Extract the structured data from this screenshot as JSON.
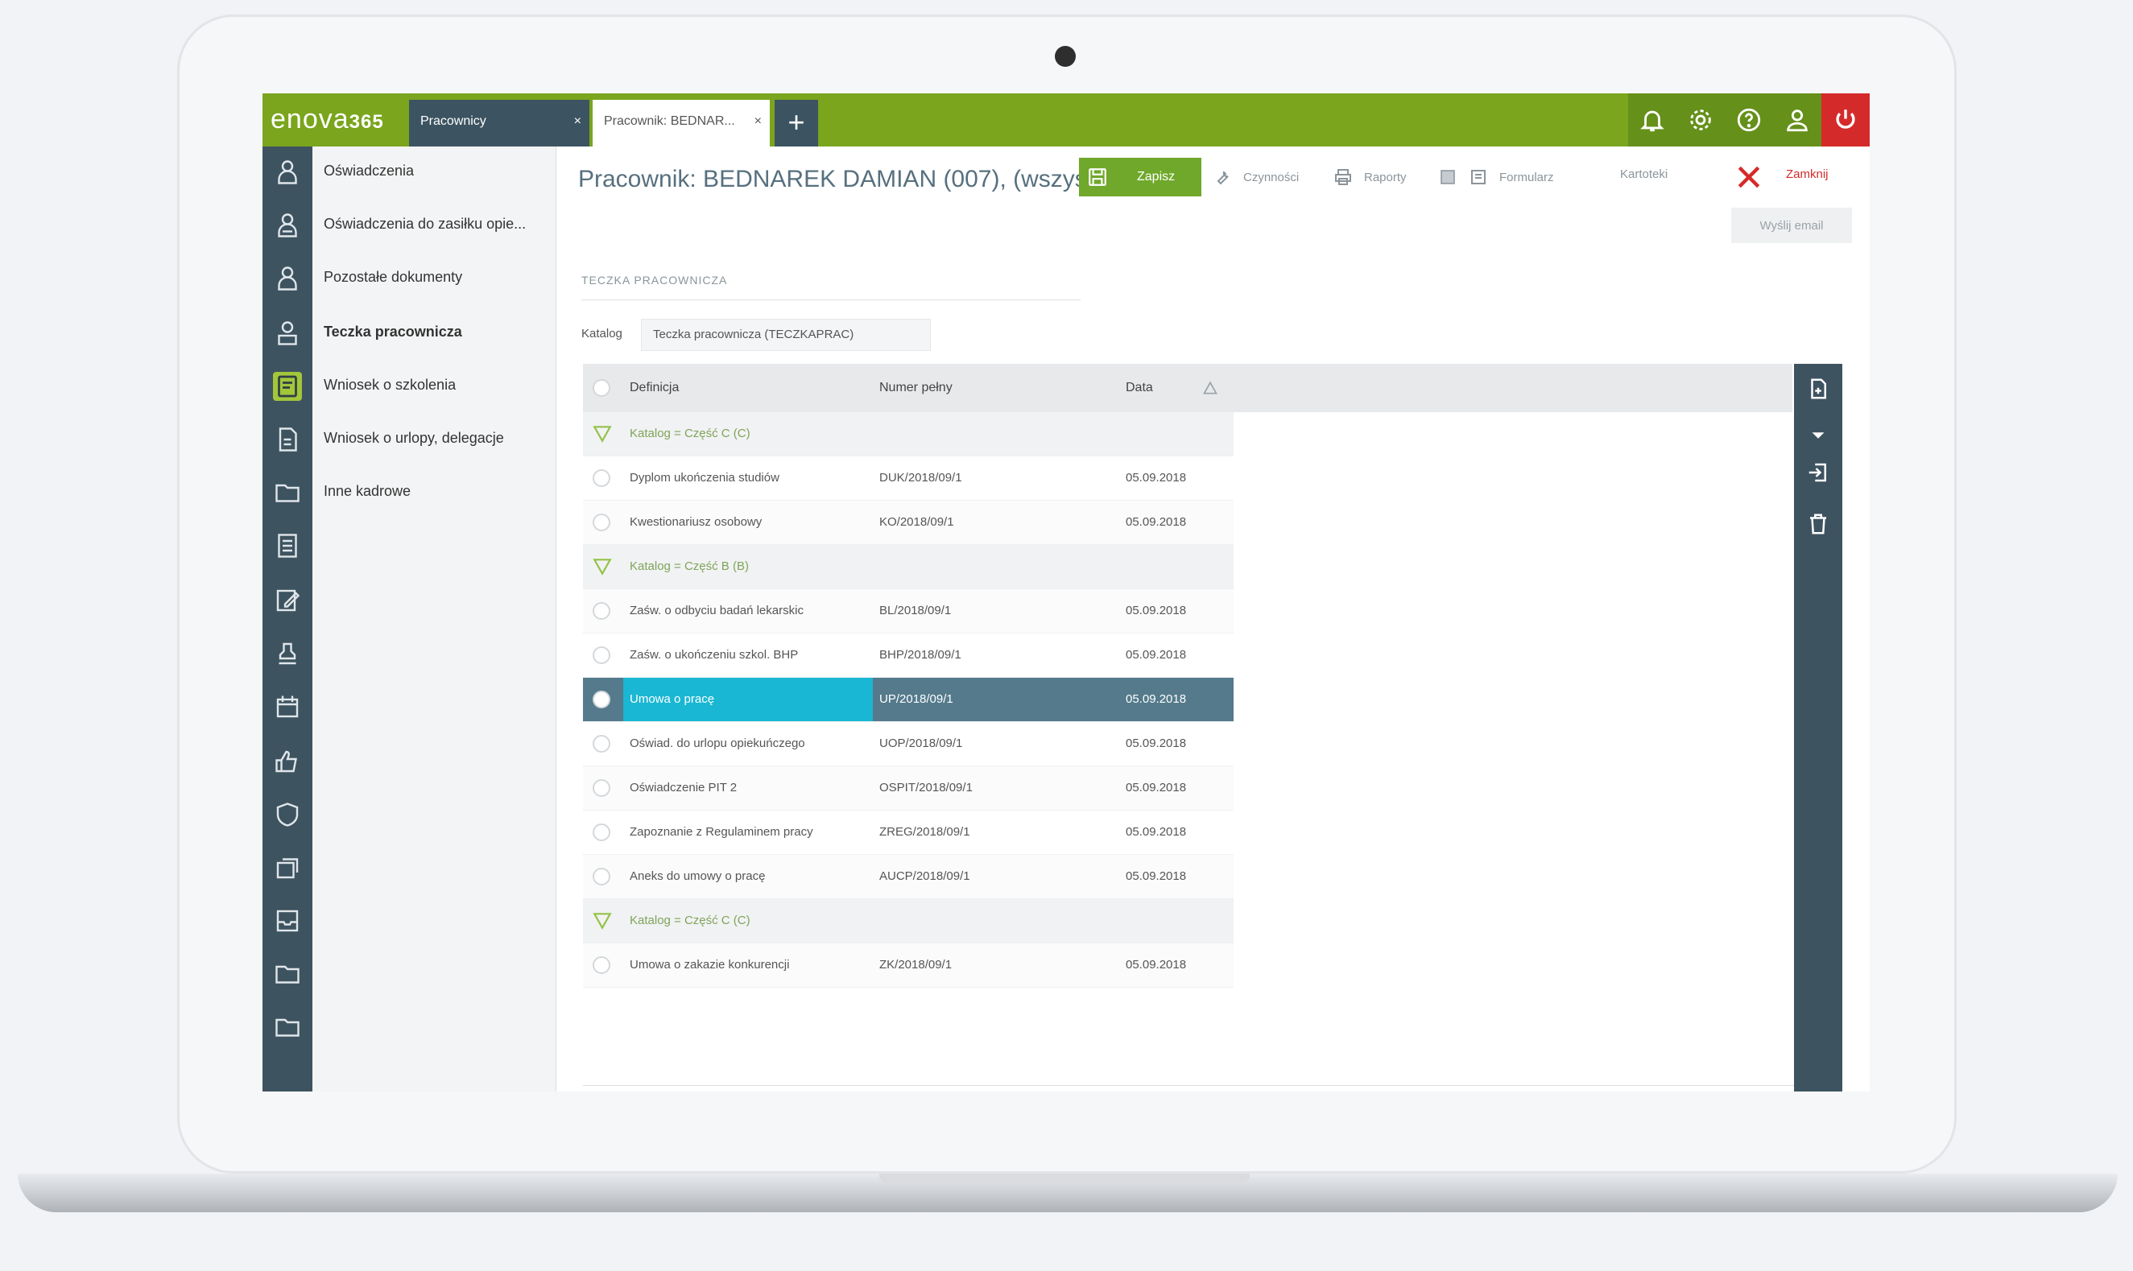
{
  "topbar": {
    "logo_text": "enova",
    "logo_number": "365",
    "tabs": [
      {
        "label": "Pracownicy",
        "close": "×"
      },
      {
        "label": "Pracownik: BEDNAR...",
        "close": "×"
      }
    ],
    "add_tab": "+",
    "icons": [
      "bell-icon",
      "gear-icon",
      "help-icon",
      "user-icon",
      "power-icon"
    ],
    "accent": "#7aa51d",
    "power_color": "#d52a2a"
  },
  "sidebar": {
    "items": [
      {
        "label": "Oświadczenia"
      },
      {
        "label": "Oświadczenia do zasiłku opie..."
      },
      {
        "label": "Pozostałe dokumenty"
      },
      {
        "label": "Teczka pracownicza"
      },
      {
        "label": "Wniosek o szkolenia"
      },
      {
        "label": "Wniosek o urlopy, delegacje"
      },
      {
        "label": "Inne kadrowe"
      }
    ]
  },
  "header": {
    "title": "Pracownik: BEDNAREK DAMIAN (007), (wszystko)",
    "save_label": "Zapisz",
    "toolbar": [
      "Czynności",
      "Raporty",
      "Formularz",
      "Kartoteki"
    ],
    "close_label": "Zamknij",
    "email_label": "Wyślij email"
  },
  "main": {
    "section_label": "TECZKA PRACOWNICZA",
    "katalog_label": "Katalog",
    "katalog_value": "Teczka pracownicza (TECZKAPRAC)",
    "columns": [
      "Definicja",
      "Numer pełny",
      "Data"
    ],
    "rows": [
      {
        "type": "group",
        "label": "Katalog = Część C (C)"
      },
      {
        "type": "row",
        "definicja": "Dyplom ukończenia studiów",
        "numer": "DUK/2018/09/1",
        "data": "05.09.2018"
      },
      {
        "type": "row",
        "definicja": "Kwestionariusz osobowy",
        "numer": "KO/2018/09/1",
        "data": "05.09.2018"
      },
      {
        "type": "group",
        "label": "Katalog = Część B (B)"
      },
      {
        "type": "row",
        "definicja": "Zaśw. o odbyciu badań lekarskic",
        "numer": "BL/2018/09/1",
        "data": "05.09.2018"
      },
      {
        "type": "row",
        "definicja": "Zaśw. o ukończeniu szkol. BHP",
        "numer": "BHP/2018/09/1",
        "data": "05.09.2018"
      },
      {
        "type": "row",
        "selected": true,
        "definicja": "Umowa o pracę",
        "numer": "UP/2018/09/1",
        "data": "05.09.2018"
      },
      {
        "type": "row",
        "definicja": "Oświad. do urlopu opiekuńczego",
        "numer": "UOP/2018/09/1",
        "data": "05.09.2018"
      },
      {
        "type": "row",
        "definicja": "Oświadczenie PIT 2",
        "numer": "OSPIT/2018/09/1",
        "data": "05.09.2018"
      },
      {
        "type": "row",
        "definicja": "Zapoznanie z Regulaminem pracy",
        "numer": "ZREG/2018/09/1",
        "data": "05.09.2018"
      },
      {
        "type": "row",
        "definicja": "Aneks do umowy o pracę",
        "numer": "AUCP/2018/09/1",
        "data": "05.09.2018"
      },
      {
        "type": "group",
        "label": "Katalog = Część C (C)"
      },
      {
        "type": "row",
        "definicja": "Umowa o zakazie konkurencji",
        "numer": "ZK/2018/09/1",
        "data": "05.09.2018"
      }
    ]
  },
  "right_rail": {
    "icons": [
      "add-document-icon",
      "dropdown-arrow-icon",
      "import-icon",
      "trash-icon"
    ]
  }
}
